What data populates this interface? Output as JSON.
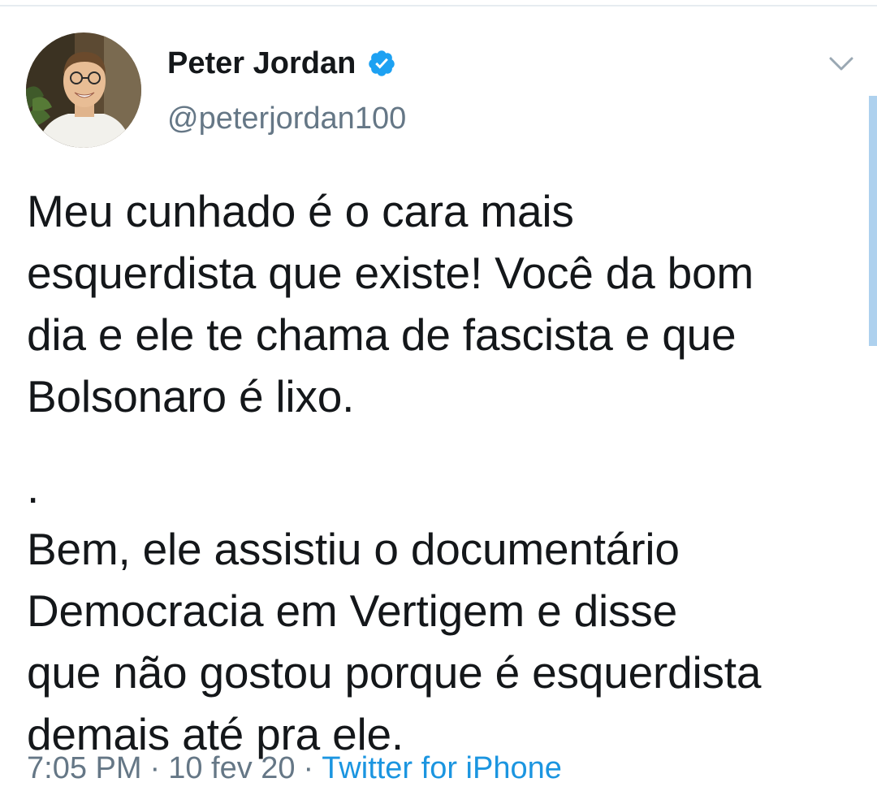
{
  "tweet": {
    "author": {
      "display_name": "Peter Jordan",
      "handle": "@peterjordan100",
      "verified": true,
      "avatar": "profile-photo"
    },
    "text_paragraphs": [
      [
        "Meu cunhado é o cara mais",
        "esquerdista que existe! Você da bom",
        "dia e ele te chama de fascista e que",
        "Bolsonaro é lixo."
      ],
      [
        ".",
        "Bem, ele assistiu o documentário",
        "Democracia em Vertigem e disse",
        "que não gostou porque é esquerdista",
        "demais até pra ele."
      ]
    ],
    "time": "7:05 PM",
    "date": "10 fev 20",
    "separator": "·",
    "source": "Twitter for iPhone"
  },
  "icons": {
    "verified": "verified-badge-icon",
    "menu": "chevron-down-icon"
  },
  "colors": {
    "text": "#14171a",
    "secondary": "#657786",
    "link": "#1b95e0",
    "verified": "#1da1f2",
    "divider": "#e6ecf0",
    "scroll_indicator": "#aed1ee"
  }
}
